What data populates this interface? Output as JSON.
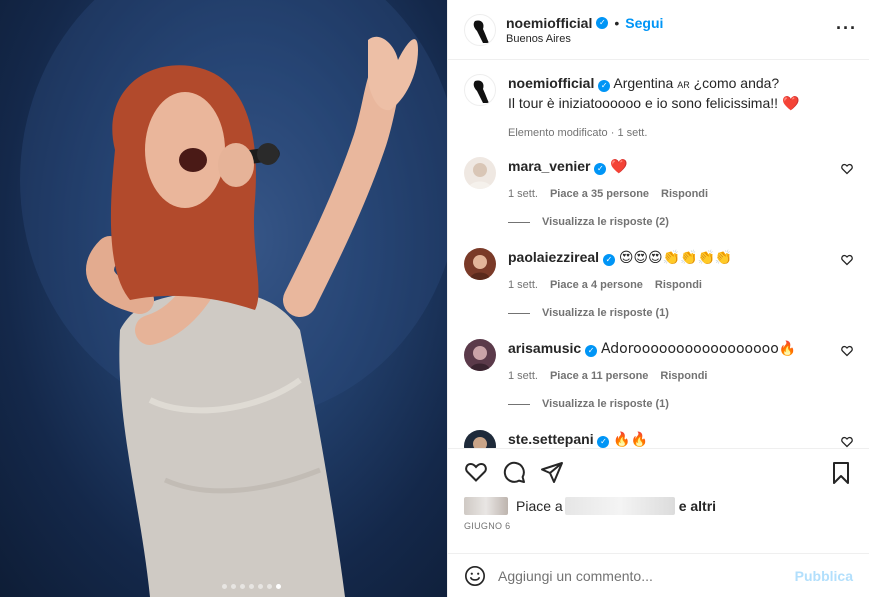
{
  "post": {
    "username": "noemiofficial",
    "follow_label": "Segui",
    "location": "Buenos Aires",
    "carousel_count": 7,
    "carousel_active_index": 6
  },
  "caption": {
    "username": "noemiofficial",
    "line1": "Argentina",
    "flag_text": "AR",
    "line1_tail": " ¿como anda?",
    "line2": "Il tour è iniziatoooooo e io sono felicissima!!",
    "emoji": "❤️",
    "edited": "Elemento modificato",
    "time": "1 sett."
  },
  "comments": [
    {
      "username": "mara_venier",
      "verified": true,
      "text": "❤️",
      "time": "1 sett.",
      "likes": "Piace a 35 persone",
      "reply": "Rispondi",
      "replies": "Visualizza le risposte (2)"
    },
    {
      "username": "paolaiezzireal",
      "verified": true,
      "text": "😍😍😍👏👏👏👏",
      "time": "1 sett.",
      "likes": "Piace a 4 persone",
      "reply": "Rispondi",
      "replies": "Visualizza le risposte (1)"
    },
    {
      "username": "arisamusic",
      "verified": true,
      "text": "Adorooooooooooooooooo🔥",
      "time": "1 sett.",
      "likes": "Piace a 11 persone",
      "reply": "Rispondi",
      "replies": "Visualizza le risposte (1)"
    },
    {
      "username": "ste.settepani",
      "verified": true,
      "text": "🔥🔥"
    }
  ],
  "likes_bar": {
    "prefix": "Piace a",
    "suffix": "e altri"
  },
  "date": "GIUGNO 6",
  "add_comment": {
    "placeholder": "Aggiungi un commento...",
    "publish": "Pubblica"
  },
  "colors": {
    "accent": "#0095f6",
    "publish_disabled": "#b2dffc",
    "heart": "#c0392b"
  },
  "icons": [
    "heart-icon",
    "comment-icon",
    "share-icon",
    "bookmark-icon",
    "emoji-icon",
    "more-icon",
    "verified-icon"
  ]
}
